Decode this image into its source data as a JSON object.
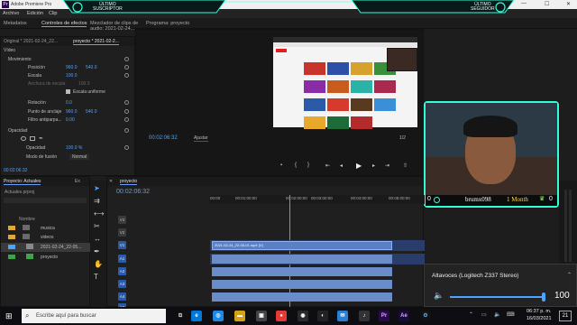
{
  "window": {
    "title": "Adobe Premiere Pro",
    "logo": "Pr"
  },
  "menu": {
    "items": [
      "Archivo",
      "Edición",
      "Clip"
    ]
  },
  "overlays": {
    "left": "ÚLTIMO\nSUSCRIPTOR",
    "right": "ÚLTIMO\nSEGUIDOR"
  },
  "workspace_tabs": [
    "Metadatos",
    "Controles de efectos",
    "Mezclador de clips de audio: 2021-02-24...",
    "Programa: proyecto"
  ],
  "effects": {
    "source_tab": "Original * 2021-02-24_22...",
    "seq_tab": "proyecto * 2021-02-2...",
    "video_label": "Vídeo",
    "movimiento": "Movimiento",
    "posicion_label": "Posición",
    "posicion_x": "960.0",
    "posicion_y": "540.0",
    "escala_label": "Escala",
    "escala_value": "100.0",
    "ancho_label": "Anchura de escala",
    "ancho_value": "100.0",
    "uniforme_label": "Escala uniforme",
    "rotacion_label": "Rotación",
    "rotacion_value": "0.0",
    "anclaje_label": "Punto de anclaje",
    "anclaje_x": "960.0",
    "anclaje_y": "540.0",
    "filtro_label": "Filtro antiparpa...",
    "filtro_value": "0.00",
    "opacidad_header": "Opacidad",
    "opacidad_label": "Opacidad",
    "opacidad_value": "100.0 %",
    "fusion_label": "Modo de fusión",
    "fusion_value": "Normal",
    "timecode": "00:02:06:32"
  },
  "program": {
    "timecode": "00:02:06:32",
    "fit": "Ajustar",
    "right_tc": "1/2",
    "end_tc": "00:05:44:27"
  },
  "project": {
    "tab": "Proyecto: Actuales",
    "tab2": "Ex",
    "file": "Actuales.prproj",
    "col_name": "Nombre",
    "items": [
      {
        "name": "musica",
        "color": "#e0a83a"
      },
      {
        "name": "videos",
        "color": "#e0a83a"
      },
      {
        "name": "2021-02-24_22-05...",
        "color": "#4aa3ff"
      },
      {
        "name": "proyecto",
        "color": "#3fa34d"
      }
    ]
  },
  "timeline": {
    "tab": "proyecto",
    "timecode": "00:02:06:32",
    "ruler": [
      "00:00",
      "00:01:00:00",
      "00:02:00:00",
      "00:03:00:00",
      "00:04:00:00",
      "00:05:00:00"
    ],
    "tracks": [
      "V3",
      "V2",
      "V1",
      "A1",
      "A2",
      "A3",
      "A4",
      "A5"
    ],
    "clip_label": "2021-02-24_22-05-01.mp4 [V]"
  },
  "webcam": {
    "username": "brumx098",
    "badge": "1 Month",
    "counter_left": "0",
    "counter_right": "0"
  },
  "volume": {
    "device": "Altavoces (Logitech Z337 Stereo)",
    "level": "100"
  },
  "taskbar": {
    "search_placeholder": "Escribe aquí para buscar",
    "time": "06:37 p. m.",
    "date": "16/03/2021",
    "notifications": "21"
  }
}
